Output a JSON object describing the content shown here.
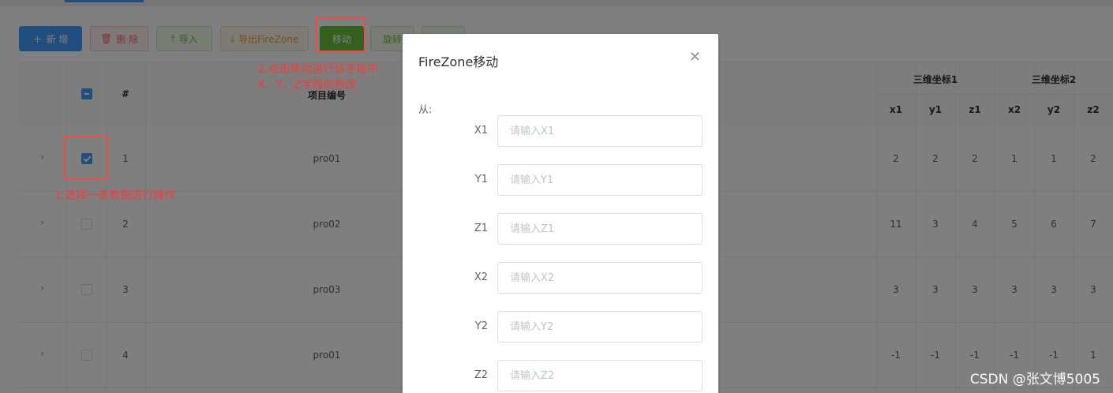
{
  "toolbar": {
    "add_label": "新 增",
    "delete_label": "删 除",
    "import_label": "导入",
    "export_label": "导出FireZone",
    "move_label": "移动",
    "rotate_label": "旋转"
  },
  "table": {
    "headers": {
      "index": "#",
      "project_no": "项目编号",
      "group1": "三维坐标1",
      "group2": "三维坐标2",
      "cols": [
        "x1",
        "y1",
        "z1",
        "x2",
        "y2",
        "z2"
      ]
    },
    "rows": [
      {
        "index": "1",
        "project_no": "pro01",
        "coords": [
          "2",
          "2",
          "2",
          "1",
          "1",
          "2"
        ],
        "selected": true
      },
      {
        "index": "2",
        "project_no": "pro02",
        "coords": [
          "11",
          "3",
          "4",
          "5",
          "6",
          "7"
        ],
        "selected": false
      },
      {
        "index": "3",
        "project_no": "pro03",
        "coords": [
          "3",
          "3",
          "3",
          "3",
          "3",
          "3"
        ],
        "selected": false
      },
      {
        "index": "4",
        "project_no": "pro01",
        "coords": [
          "-1",
          "-1",
          "-1",
          "-1",
          "-1",
          "1"
        ],
        "selected": false
      }
    ]
  },
  "annotations": {
    "step1": "1.选择一条数据进行操作",
    "step2_line1": "2.点击移动进行该字段中",
    "step2_line2": "X、Y、Z字段的修改",
    "color": "#f23c3c"
  },
  "dialog": {
    "title": "FireZone移动",
    "close_icon": "close-icon",
    "section_label": "从:",
    "fields": [
      {
        "label": "X1",
        "placeholder": "请输入X1",
        "value": ""
      },
      {
        "label": "Y1",
        "placeholder": "请输入Y1",
        "value": ""
      },
      {
        "label": "Z1",
        "placeholder": "请输入Z1",
        "value": ""
      },
      {
        "label": "X2",
        "placeholder": "请输入X2",
        "value": ""
      },
      {
        "label": "Y2",
        "placeholder": "请输入Y2",
        "value": ""
      },
      {
        "label": "Z2",
        "placeholder": "请输入Z2",
        "value": ""
      }
    ]
  },
  "watermark": "CSDN @张文博5005",
  "colors": {
    "primary": "#409eff",
    "success": "#67c23a",
    "danger": "#f56c6c",
    "warning": "#e6a23c"
  }
}
